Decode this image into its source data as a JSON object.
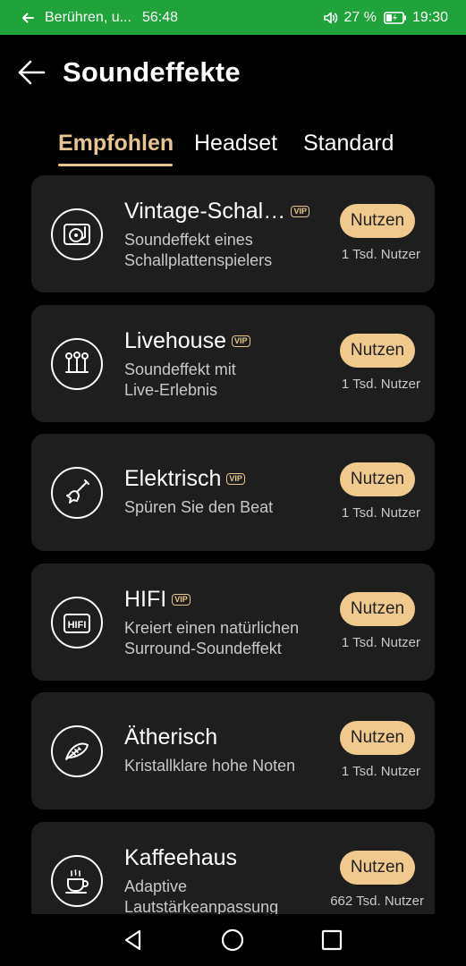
{
  "status_bar": {
    "notification_text": "Berühren, u...",
    "timer": "56:48",
    "battery_percent": "27 %",
    "clock": "19:30",
    "color": "#1fa33a"
  },
  "header": {
    "back_icon": "back-arrow-icon",
    "title": "Soundeffekte"
  },
  "tabs": [
    {
      "label": "Empfohlen",
      "active": true
    },
    {
      "label": "Headset",
      "active": false
    },
    {
      "label": "Standard",
      "active": false
    }
  ],
  "accent_color": "#e8c48e",
  "effects": [
    {
      "icon": "turntable-icon",
      "title": "Vintage-Schall...",
      "vip": "VIP",
      "desc1": "Soundeffekt eines",
      "desc2": "Schallplattenspielers",
      "button": "Nutzen",
      "users": "1 Tsd. Nutzer"
    },
    {
      "icon": "microphones-icon",
      "title": "Livehouse",
      "vip": "VIP",
      "desc1": "Soundeffekt mit",
      "desc2": "Live-Erlebnis",
      "button": "Nutzen",
      "users": "1 Tsd. Nutzer"
    },
    {
      "icon": "electric-guitar-icon",
      "title": "Elektrisch",
      "vip": "VIP",
      "desc1": "Spüren Sie den Beat",
      "desc2": "",
      "button": "Nutzen",
      "users": "1 Tsd. Nutzer"
    },
    {
      "icon": "hifi-icon",
      "title": "HIFI",
      "vip": "VIP",
      "desc1": "Kreiert einen natürlichen",
      "desc2": "Surround-Soundeffekt",
      "button": "Nutzen",
      "users": "1 Tsd. Nutzer"
    },
    {
      "icon": "feather-icon",
      "title": "Ätherisch",
      "vip": "",
      "desc1": "Kristallklare hohe Noten",
      "desc2": "",
      "button": "Nutzen",
      "users": "1 Tsd. Nutzer"
    },
    {
      "icon": "coffee-cup-icon",
      "title": "Kaffeehaus",
      "vip": "",
      "desc1": "Adaptive",
      "desc2": "Lautstärkeanpassung",
      "button": "Nutzen",
      "users": "662 Tsd. Nutzer"
    }
  ],
  "nav": {
    "back": "nav-back-icon",
    "home": "nav-home-icon",
    "recents": "nav-recents-icon"
  }
}
